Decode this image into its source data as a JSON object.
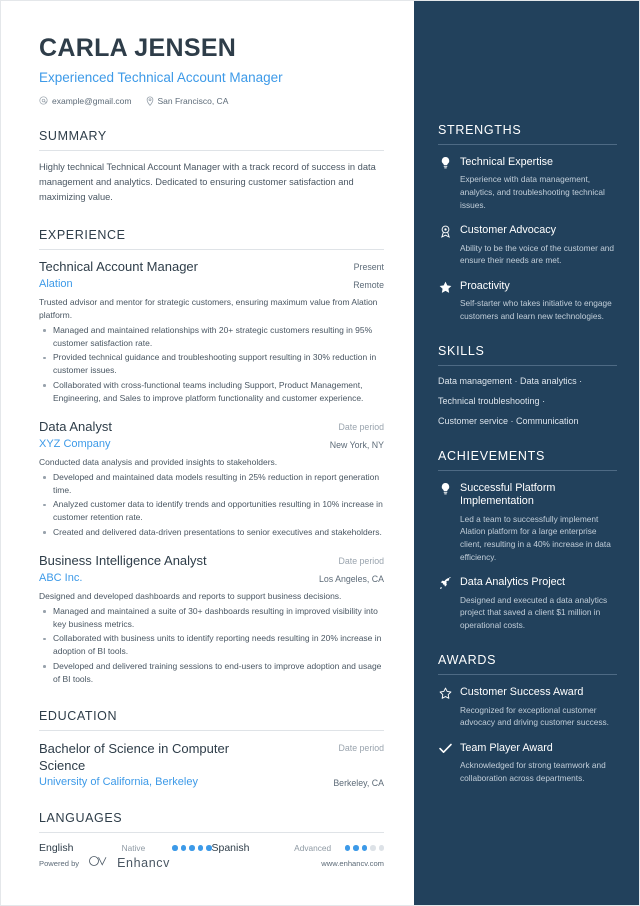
{
  "header": {
    "name": "CARLA JENSEN",
    "job_title": "Experienced Technical Account Manager",
    "email": "example@gmail.com",
    "location": "San Francisco, CA",
    "email_icon": "at-sign-icon",
    "location_icon": "map-pin-icon"
  },
  "summary": {
    "title": "SUMMARY",
    "text": "Highly technical Technical Account Manager with a track record of success in data management and analytics. Dedicated to ensuring customer satisfaction and maximizing value."
  },
  "experience": {
    "title": "EXPERIENCE",
    "entries": [
      {
        "role": "Technical Account Manager",
        "date": "Present",
        "org": "Alation",
        "location": "Remote",
        "description": "Trusted advisor and mentor for strategic customers, ensuring maximum value from Alation platform.",
        "bullets": [
          "Managed and maintained relationships with 20+ strategic customers resulting in 95% customer satisfaction rate.",
          "Provided technical guidance and troubleshooting support resulting in 30% reduction in customer issues.",
          "Collaborated with cross-functional teams including Support, Product Management, Engineering, and Sales to improve platform functionality and customer experience."
        ]
      },
      {
        "role": "Data Analyst",
        "date": "Date period",
        "org": "XYZ Company",
        "location": "New York, NY",
        "description": "Conducted data analysis and provided insights to stakeholders.",
        "bullets": [
          "Developed and maintained data models resulting in 25% reduction in report generation time.",
          "Analyzed customer data to identify trends and opportunities resulting in 10% increase in customer retention rate.",
          "Created and delivered data-driven presentations to senior executives and stakeholders."
        ]
      },
      {
        "role": "Business Intelligence Analyst",
        "date": "Date period",
        "org": "ABC Inc.",
        "location": "Los Angeles, CA",
        "description": "Designed and developed dashboards and reports to support business decisions.",
        "bullets": [
          "Managed and maintained a suite of 30+ dashboards resulting in improved visibility into key business metrics.",
          "Collaborated with business units to identify reporting needs resulting in 20% increase in adoption of BI tools.",
          "Developed and delivered training sessions to end-users to improve adoption and usage of BI tools."
        ]
      }
    ]
  },
  "education": {
    "title": "EDUCATION",
    "entries": [
      {
        "degree": "Bachelor of Science in Computer Science",
        "date": "Date period",
        "school": "University of California, Berkeley",
        "location": "Berkeley, CA"
      }
    ]
  },
  "languages": {
    "title": "LANGUAGES",
    "items": [
      {
        "name": "English",
        "level": "Native",
        "filled": 5,
        "total": 5
      },
      {
        "name": "Spanish",
        "level": "Advanced",
        "filled": 3,
        "total": 5
      }
    ]
  },
  "footer": {
    "powered_by": "Powered by",
    "brand": "Enhancv",
    "brand_icon": "enhancv-logo-icon",
    "url": "www.enhancv.com"
  },
  "strengths": {
    "title": "STRENGTHS",
    "items": [
      {
        "icon": "lightbulb-icon",
        "title": "Technical Expertise",
        "desc": "Experience with data management, analytics, and troubleshooting technical issues."
      },
      {
        "icon": "award-medal-icon",
        "title": "Customer Advocacy",
        "desc": "Ability to be the voice of the customer and ensure their needs are met."
      },
      {
        "icon": "star-filled-icon",
        "title": "Proactivity",
        "desc": "Self-starter who takes initiative to engage customers and learn new technologies."
      }
    ]
  },
  "skills": {
    "title": "SKILLS",
    "lines": [
      "Data management · Data analytics ·",
      "Technical troubleshooting ·",
      "Customer service · Communication"
    ]
  },
  "achievements": {
    "title": "ACHIEVEMENTS",
    "items": [
      {
        "icon": "lightbulb-icon",
        "title": "Successful Platform Implementation",
        "desc": "Led a team to successfully implement Alation platform for a large enterprise client, resulting in a 40% increase in data efficiency."
      },
      {
        "icon": "rocket-icon",
        "title": "Data Analytics Project",
        "desc": "Designed and executed a data analytics project that saved a client $1 million in operational costs."
      }
    ]
  },
  "awards": {
    "title": "AWARDS",
    "items": [
      {
        "icon": "star-outline-icon",
        "title": "Customer Success Award",
        "desc": "Recognized for exceptional customer advocacy and driving customer success."
      },
      {
        "icon": "check-icon",
        "title": "Team Player Award",
        "desc": "Acknowledged for strong teamwork and collaboration across departments."
      }
    ]
  },
  "colors": {
    "accent_blue": "#3d9ae8",
    "sidebar_bg": "#22415c",
    "heading_dark": "#2e3d49"
  }
}
